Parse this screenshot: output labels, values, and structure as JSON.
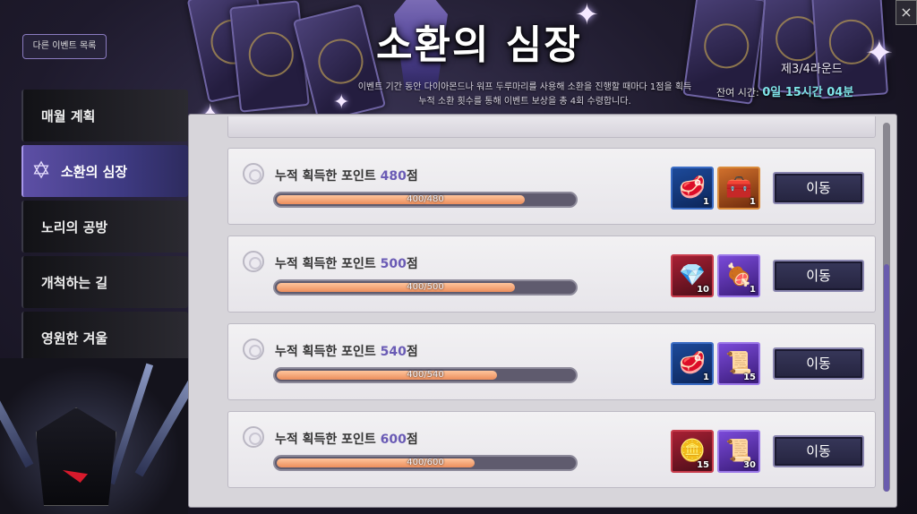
{
  "window": {
    "close_label": "×"
  },
  "header": {
    "other_events_label": "다른 이벤트 목록",
    "title": "소환의 심장",
    "round": "제3/4라운드",
    "description_line1": "이벤트 기간 동안 다이아몬드나 워프 두루마리를 사용해 소환을 진행할 때마다 1점을 획득",
    "description_line2": "누적 소환 횟수를 통해 이벤트 보상을 총 4회 수령합니다.",
    "remaining_label": "잔여 시간:",
    "remaining_time": "0일 15시간 04분"
  },
  "sidebar": {
    "items": [
      {
        "label": "매월 계획",
        "active": false
      },
      {
        "label": "소환의 심장",
        "active": true,
        "icon": "summon-star-icon"
      },
      {
        "label": "노리의 공방",
        "active": false
      },
      {
        "label": "개척하는 길",
        "active": false
      },
      {
        "label": "영원한 겨울",
        "active": false
      }
    ]
  },
  "rewards": [
    {
      "label_prefix": "누적 획득한 포인트",
      "points": "480",
      "unit": "점",
      "progress_text": "400/480",
      "progress": 0.833,
      "items": [
        {
          "icon": "meat-icon",
          "qty": "1",
          "color": "blue"
        },
        {
          "icon": "treasure-chest-icon",
          "qty": "1",
          "color": "orange"
        }
      ],
      "button_label": "이동"
    },
    {
      "label_prefix": "누적 획득한 포인트",
      "points": "500",
      "unit": "점",
      "progress_text": "400/500",
      "progress": 0.8,
      "items": [
        {
          "icon": "purple-crystal-icon",
          "qty": "10",
          "color": "red"
        },
        {
          "icon": "steak-plate-icon",
          "qty": "1",
          "color": "purple"
        }
      ],
      "button_label": "이동"
    },
    {
      "label_prefix": "누적 획득한 포인트",
      "points": "540",
      "unit": "점",
      "progress_text": "400/540",
      "progress": 0.741,
      "items": [
        {
          "icon": "meat-icon",
          "qty": "1",
          "color": "blue"
        },
        {
          "icon": "scroll-shard-icon",
          "qty": "15",
          "color": "purple"
        }
      ],
      "button_label": "이동"
    },
    {
      "label_prefix": "누적 획득한 포인트",
      "points": "600",
      "unit": "점",
      "progress_text": "400/600",
      "progress": 0.667,
      "items": [
        {
          "icon": "silver-coin-icon",
          "qty": "15",
          "color": "red"
        },
        {
          "icon": "scroll-shard-icon",
          "qty": "30",
          "color": "purple"
        }
      ],
      "button_label": "이동"
    }
  ]
}
